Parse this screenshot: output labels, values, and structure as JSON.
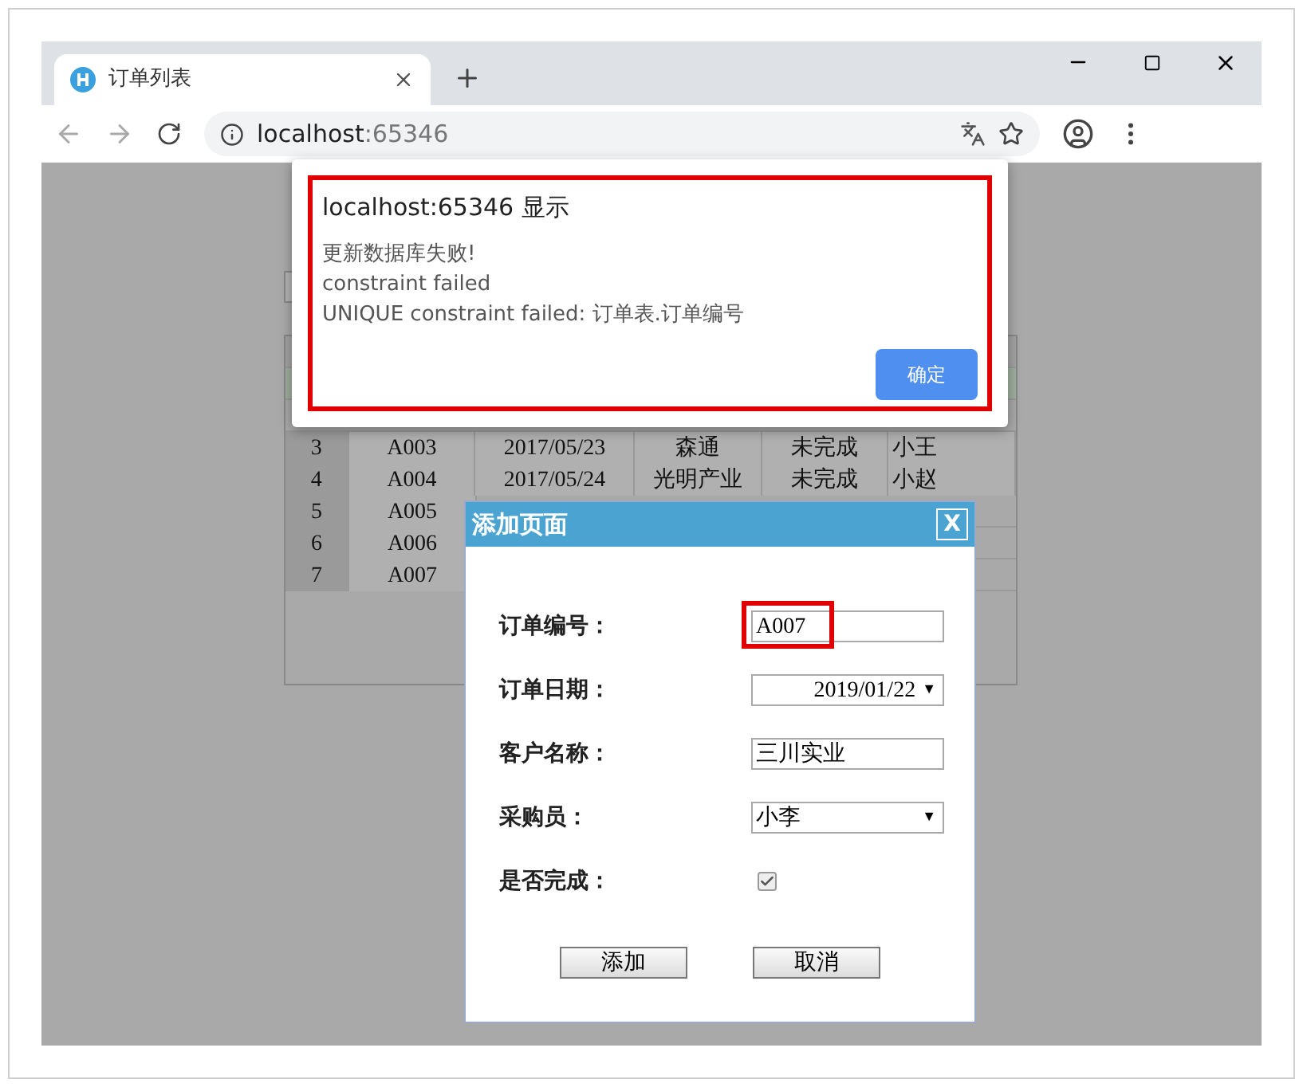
{
  "browser": {
    "tab": {
      "title": "订单列表"
    },
    "address": {
      "host": "localhost",
      "port": ":65346"
    }
  },
  "page": {
    "table": {
      "rows": [
        {
          "cells": [
            "3",
            "A003",
            "2017/05/23",
            "森通",
            "未完成",
            "小王"
          ]
        },
        {
          "cells": [
            "4",
            "A004",
            "2017/05/24",
            "光明产业",
            "未完成",
            "小赵"
          ]
        },
        {
          "cells": [
            "5",
            "A005"
          ]
        },
        {
          "cells": [
            "6",
            "A006"
          ]
        },
        {
          "cells": [
            "7",
            "A007"
          ]
        }
      ]
    }
  },
  "alert": {
    "title": "localhost:65346 显示",
    "highlighted": true,
    "lines": [
      "更新数据库失败!",
      "constraint failed",
      "UNIQUE constraint failed: 订单表.订单编号"
    ],
    "ok_button": "确定"
  },
  "dialog": {
    "title": "添加页面",
    "close": "X",
    "fields": [
      {
        "kind": "text",
        "label": "订单编号：",
        "value": "A007",
        "highlighted": true
      },
      {
        "kind": "select",
        "label": "订单日期：",
        "value": "2019/01/22",
        "arrow": "▼",
        "highlighted": false
      },
      {
        "kind": "text",
        "label": "客户名称：",
        "value": "三川实业",
        "highlighted": false
      },
      {
        "kind": "select",
        "label": "采购员：",
        "value": "小李",
        "arrow": "▼",
        "highlighted": false
      },
      {
        "kind": "checkbox",
        "label": "是否完成：",
        "checked": true,
        "highlighted": false
      }
    ],
    "buttons": [
      "添加",
      "取消"
    ]
  }
}
